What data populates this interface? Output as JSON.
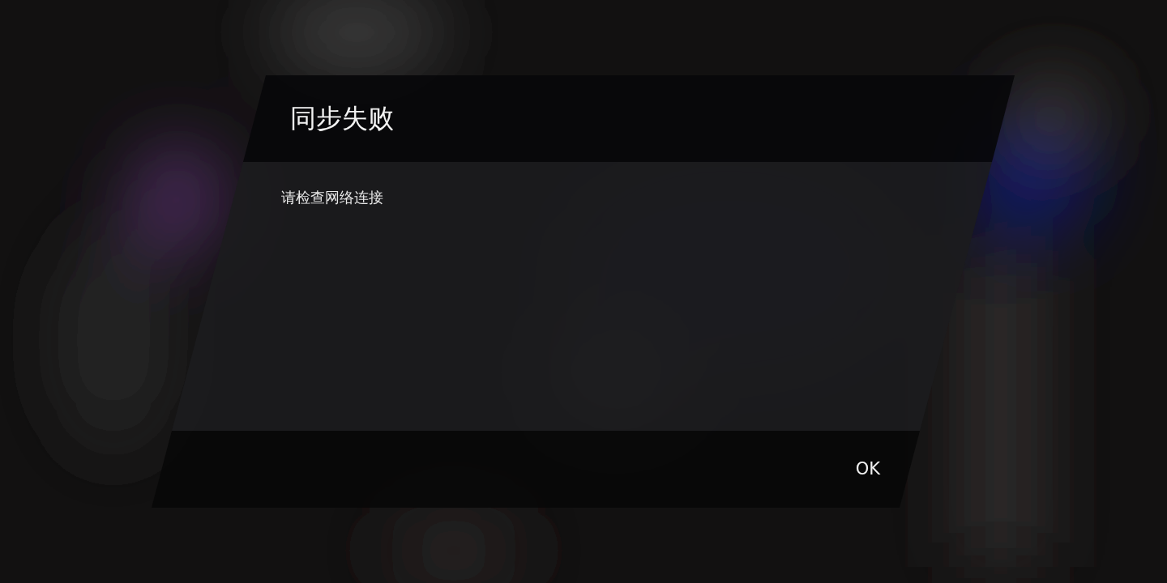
{
  "dialog": {
    "title": "同步失败",
    "message": "请检查网络连接",
    "buttons": [
      "OK"
    ]
  }
}
